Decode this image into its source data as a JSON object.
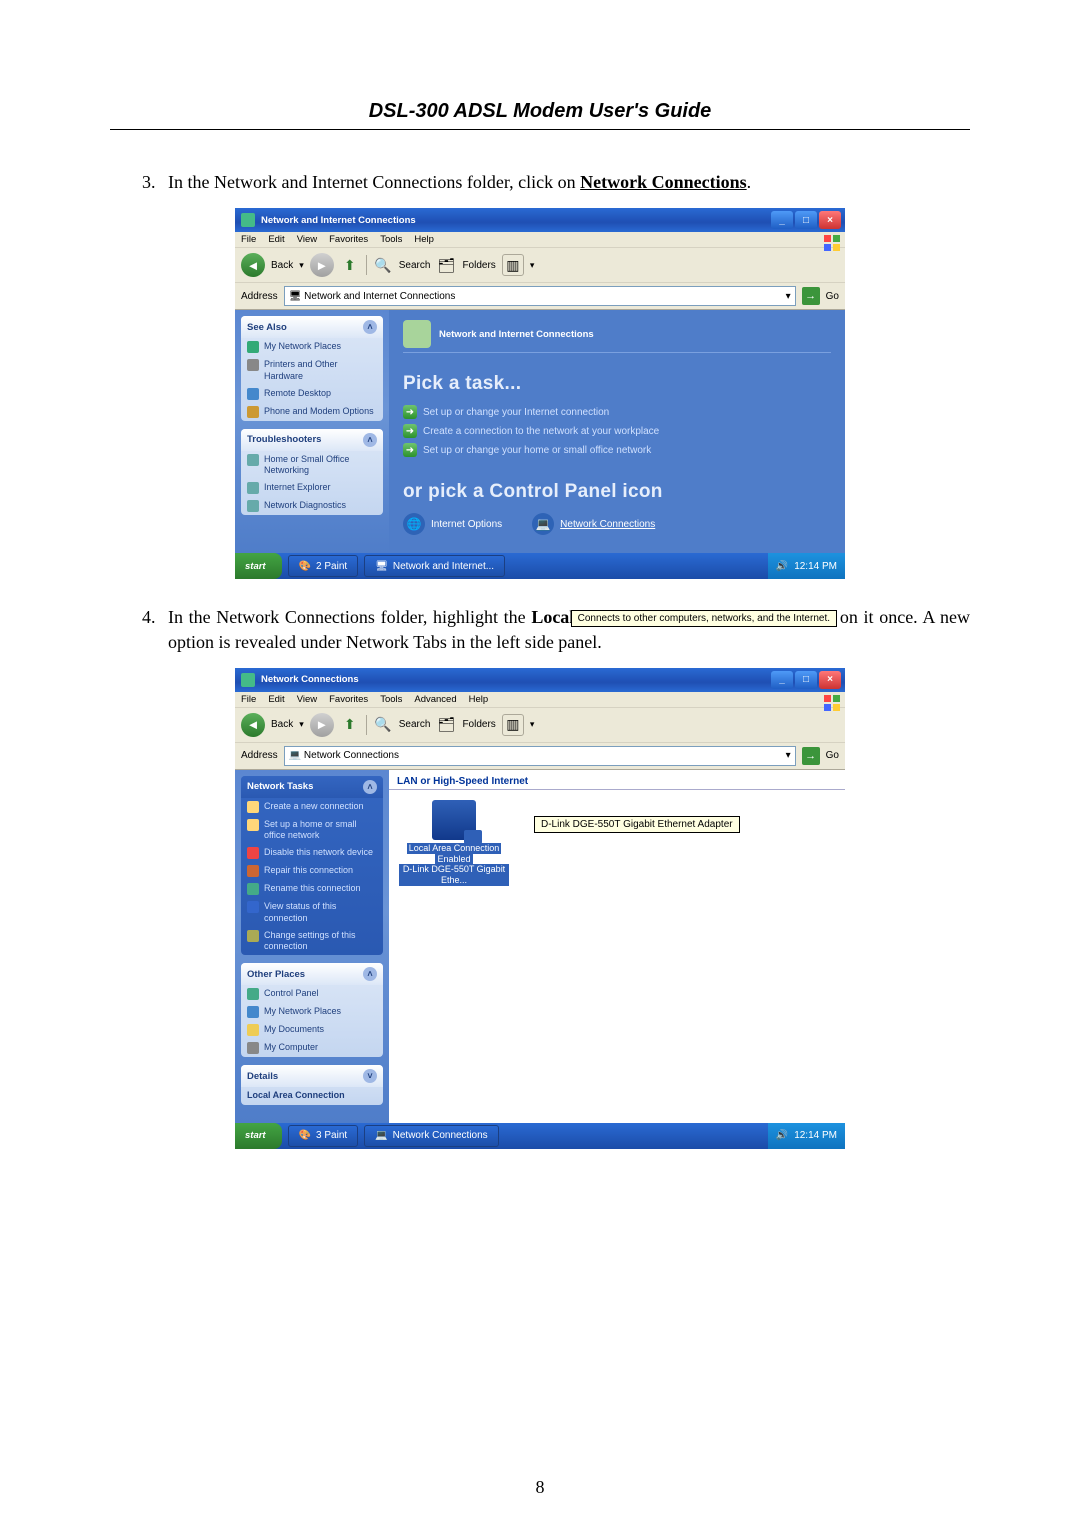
{
  "doc": {
    "header": "DSL-300 ADSL Modem User's Guide",
    "page_number": "8",
    "step3_prefix": "In the Network and Internet Connections folder, click on ",
    "step3_link": "Network Connections",
    "step3_suffix": ".",
    "step4_a": "In the Network Connections folder, highlight the ",
    "step4_b": "Local Area Connection",
    "step4_c": " icon by clicking on it once. A new option is revealed under Network Tabs in the left side panel."
  },
  "shot1": {
    "title": "Network and Internet Connections",
    "menu": [
      "File",
      "Edit",
      "View",
      "Favorites",
      "Tools",
      "Help"
    ],
    "tb_back": "Back",
    "tb_search": "Search",
    "tb_folders": "Folders",
    "addr_label": "Address",
    "addr_value": "Network and Internet Connections",
    "addr_go": "Go",
    "panel_seealso": "See Also",
    "seealso": [
      "My Network Places",
      "Printers and Other Hardware",
      "Remote Desktop",
      "Phone and Modem Options"
    ],
    "panel_trouble": "Troubleshooters",
    "trouble": [
      "Home or Small Office Networking",
      "Internet Explorer",
      "Network Diagnostics"
    ],
    "cp_head": "Network and Internet Connections",
    "cp_pick_task": "Pick a task...",
    "cp_tasks": [
      "Set up or change your Internet connection",
      "Create a connection to the network at your workplace",
      "Set up or change your home or small office network"
    ],
    "cp_pick_icon": "or pick a Control Panel icon",
    "cp_icons": [
      "Internet Options",
      "Network Connections"
    ],
    "tooltip": "Connects to other computers, networks, and the Internet.",
    "taskbar_app": "Network and Internet...",
    "start": "start",
    "taskbar_apps_left": "2  Paint",
    "tray": "12:14 PM"
  },
  "shot2": {
    "title": "Network Connections",
    "menu": [
      "File",
      "Edit",
      "View",
      "Favorites",
      "Tools",
      "Advanced",
      "Help"
    ],
    "tb_back": "Back",
    "tb_search": "Search",
    "tb_folders": "Folders",
    "addr_label": "Address",
    "addr_value": "Network Connections",
    "addr_go": "Go",
    "panel_tasks": "Network Tasks",
    "tasks": [
      "Create a new connection",
      "Set up a home or small office network",
      "Disable this network device",
      "Repair this connection",
      "Rename this connection",
      "View status of this connection",
      "Change settings of this connection"
    ],
    "panel_other": "Other Places",
    "other": [
      "Control Panel",
      "My Network Places",
      "My Documents",
      "My Computer"
    ],
    "panel_details": "Details",
    "details_line": "Local Area Connection",
    "group": "LAN or High-Speed Internet",
    "icon_line1": "Local Area Connection",
    "icon_line2": "Enabled",
    "icon_line3": "D-Link DGE-550T Gigabit Ethe...",
    "tooltip": "D-Link DGE-550T Gigabit Ethernet Adapter",
    "taskbar_app": "Network Connections",
    "start": "start",
    "taskbar_apps_left": "3  Paint",
    "tray": "12:14 PM"
  }
}
